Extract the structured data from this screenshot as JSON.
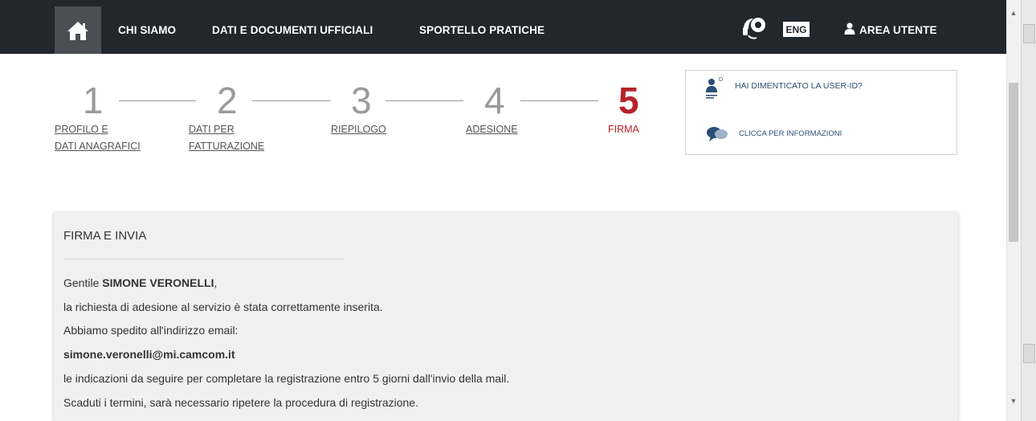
{
  "navbar": {
    "home_icon": "home-icon",
    "links": [
      "CHI SIAMO",
      "DATI E DOCUMENTI UFFICIALI",
      "SPORTELLO PRATICHE"
    ],
    "support_icon": "headset-icon",
    "lang": "ENG",
    "user_area": "AREA UTENTE",
    "bg_color": "#22262d"
  },
  "steps": [
    {
      "num": "1",
      "label_line1": "PROFILO E",
      "label_line2": "DATI ANAGRAFICI"
    },
    {
      "num": "2",
      "label_line1": "DATI PER",
      "label_line2": "FATTURAZIONE"
    },
    {
      "num": "3",
      "label_line1": "RIEPILOGO",
      "label_line2": ""
    },
    {
      "num": "4",
      "label_line1": "ADESIONE",
      "label_line2": ""
    },
    {
      "num": "5",
      "label_line1": "FIRMA",
      "label_line2": "",
      "active": true
    }
  ],
  "active_color": "#b5232a",
  "help": {
    "forgot_userid": "HAI DIMENTICATO LA USER-ID?",
    "info": "CLICCA PER INFORMAZIONI"
  },
  "panel": {
    "title": "FIRMA E INVIA",
    "greeting_prefix": "Gentile",
    "name": "SIMONE VERONELLI",
    "greeting_suffix": ",",
    "line1": "la richiesta di adesione al servizio è stata correttamente inserita.",
    "line2": "Abbiamo spedito all'indirizzo email:",
    "email": "simone.veronelli@mi.camcom.it",
    "line3": "le indicazioni da seguire per completare la registrazione entro 5 giorni dall'invio della mail.",
    "line4": "Scaduti i termini, sarà necessario ripetere la procedura di registrazione."
  }
}
